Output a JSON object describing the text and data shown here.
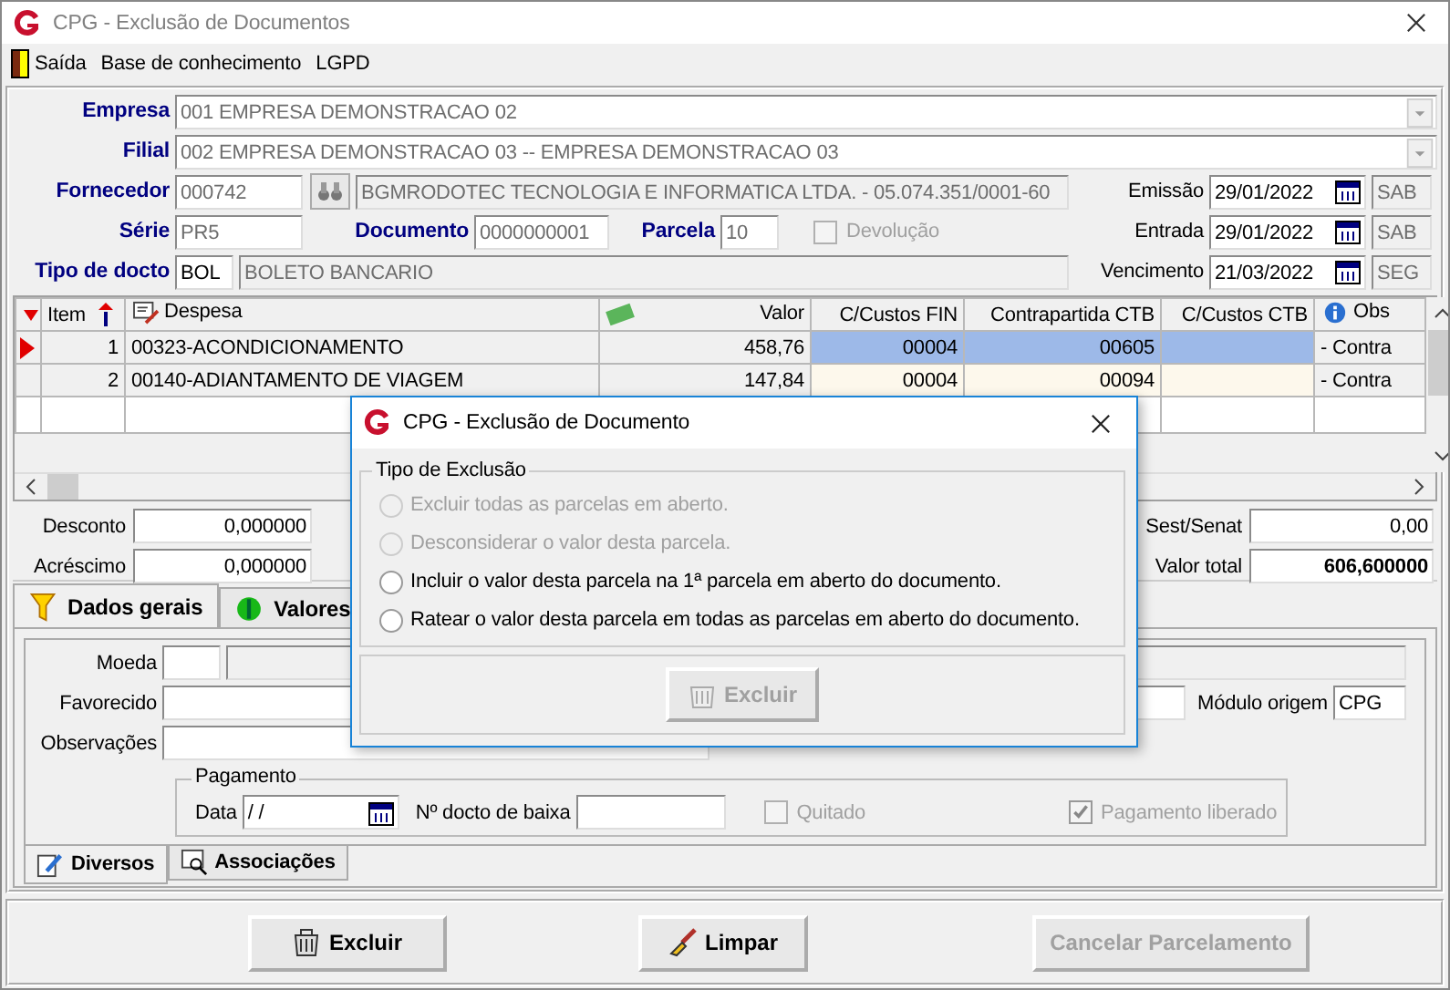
{
  "window": {
    "title": "CPG - Exclusão de Documentos"
  },
  "menu": [
    {
      "label": "Saída",
      "kind": "exit"
    },
    {
      "label": "Base de conhecimento",
      "kind": "text"
    },
    {
      "label": "LGPD",
      "kind": "text"
    }
  ],
  "header": {
    "empresa": {
      "label": "Empresa",
      "value": "001 EMPRESA DEMONSTRACAO 02"
    },
    "filial": {
      "label": "Filial",
      "value": "002 EMPRESA DEMONSTRACAO 03 -- EMPRESA DEMONSTRACAO 03"
    },
    "fornecedor": {
      "label": "Fornecedor",
      "code": "000742",
      "name": "BGMRODOTEC TECNOLOGIA E INFORMATICA LTDA. - 05.074.351/0001-60"
    },
    "serie": {
      "label": "Série",
      "value": "PR5"
    },
    "documento": {
      "label": "Documento",
      "value": "0000000001"
    },
    "parcela": {
      "label": "Parcela",
      "value": "10"
    },
    "devolucao": {
      "label": "Devolução",
      "checked": false,
      "disabled": true
    },
    "tipo_docto": {
      "label": "Tipo de docto",
      "code": "BOL",
      "name": "BOLETO BANCARIO"
    }
  },
  "dates": [
    {
      "label": "Emissão",
      "value": "29/01/2022",
      "day": "SAB"
    },
    {
      "label": "Entrada",
      "value": "29/01/2022",
      "day": "SAB"
    },
    {
      "label": "Vencimento",
      "value": "21/03/2022",
      "day": "SEG"
    }
  ],
  "grid": {
    "columns": [
      {
        "label": "Item",
        "kind": "sort"
      },
      {
        "label": "Despesa",
        "kind": "note"
      },
      {
        "label": "Valor",
        "kind": "money"
      },
      {
        "label": "C/Custos FIN",
        "kind": "plain"
      },
      {
        "label": "Contrapartida CTB",
        "kind": "plain"
      },
      {
        "label": "C/Custos CTB",
        "kind": "plain"
      },
      {
        "label": "Obs",
        "kind": "info"
      }
    ],
    "rows": [
      {
        "selected": true,
        "item": "1",
        "despesa": "00323-ACONDICIONAMENTO",
        "valor": "458,76",
        "cc_fin": "00004",
        "contrapartida": "00605",
        "obs": "- Contra"
      },
      {
        "selected": false,
        "item": "2",
        "despesa": "00140-ADIANTAMENTO DE VIAGEM",
        "valor": "147,84",
        "cc_fin": "00004",
        "contrapartida": "00094",
        "obs": "- Contra"
      }
    ]
  },
  "totals": [
    {
      "label": "Desconto",
      "value": "0,000000"
    },
    {
      "label": "Acréscimo",
      "value": "0,000000"
    }
  ],
  "summary": [
    {
      "label": "Sest/Senat",
      "value": "0,00",
      "bold": false
    },
    {
      "label": "Valor total",
      "value": "606,600000",
      "bold": true
    }
  ],
  "tabs": [
    {
      "label": "Dados gerais",
      "selected": true,
      "kind": "filter"
    },
    {
      "label": "Valores",
      "selected": false,
      "kind": "money"
    }
  ],
  "dados": {
    "moeda": {
      "label": "Moeda"
    },
    "favorecido": {
      "label": "Favorecido"
    },
    "modulo_origem": {
      "label": "Módulo origem",
      "value": "CPG"
    },
    "observacoes": {
      "label": "Observações"
    },
    "pagamento": {
      "title": "Pagamento",
      "data": {
        "label": "Data",
        "value": "/ /"
      },
      "docto_baixa": {
        "label": "Nº docto de baixa"
      },
      "checks": [
        {
          "label": "Quitado",
          "checked": false,
          "disabled": true
        },
        {
          "label": "Pagamento liberado",
          "checked": true,
          "disabled": true
        }
      ]
    }
  },
  "subtabs": [
    {
      "label": "Diversos",
      "selected": true,
      "kind": "note"
    },
    {
      "label": "Associações",
      "selected": false,
      "kind": "search"
    }
  ],
  "buttons": [
    {
      "label": "Excluir",
      "kind": "trash",
      "disabled": false
    },
    {
      "label": "Limpar",
      "kind": "broom",
      "disabled": false
    },
    {
      "label": "Cancelar Parcelamento",
      "kind": "plain",
      "disabled": true
    }
  ],
  "dialog": {
    "title": "CPG - Exclusão de Documento",
    "group": "Tipo de Exclusão",
    "options": [
      {
        "label": "Excluir todas as parcelas em aberto.",
        "selected": false,
        "disabled": true
      },
      {
        "label": "Desconsiderar o valor desta  parcela.",
        "selected": false,
        "disabled": true
      },
      {
        "label": "Incluir o valor desta parcela na 1ª parcela em aberto do documento.",
        "selected": false,
        "disabled": false
      },
      {
        "label": "Ratear o valor desta parcela em todas as parcelas em aberto do documento.",
        "selected": false,
        "disabled": false
      }
    ],
    "button": {
      "label": "Excluir",
      "disabled": true
    }
  }
}
